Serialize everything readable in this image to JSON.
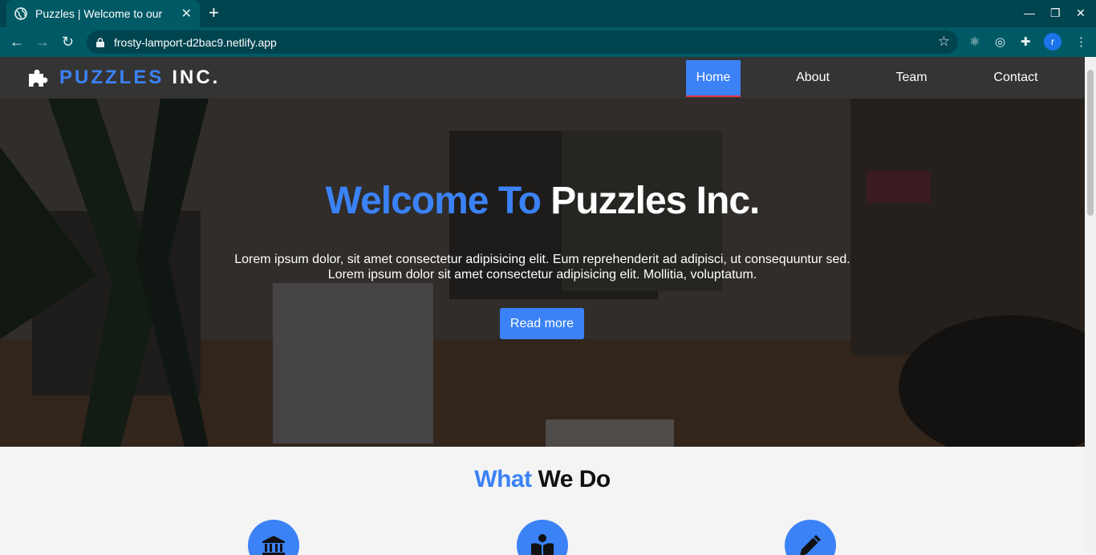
{
  "browser": {
    "tab_title": "Puzzles | Welcome to our",
    "url": "frosty-lamport-d2bac9.netlify.app",
    "profile_initial": "r"
  },
  "navbar": {
    "brand_part1": "PUZZLES",
    "brand_part2": "INC.",
    "items": [
      {
        "label": "Home",
        "active": true
      },
      {
        "label": "About",
        "active": false
      },
      {
        "label": "Team",
        "active": false
      },
      {
        "label": "Contact",
        "active": false
      }
    ]
  },
  "hero": {
    "title_part1": "Welcome To",
    "title_part2": "Puzzles Inc.",
    "text_line1": "Lorem ipsum dolor, sit amet consectetur adipisicing elit. Eum reprehenderit ad adipisci, ut consequuntur sed.",
    "text_line2": "Lorem ipsum dolor sit amet consectetur adipisicing elit. Mollitia, voluptatum.",
    "button_label": "Read more"
  },
  "what_we_do": {
    "title_part1": "What",
    "title_part2": "We Do",
    "icons": [
      "bank-icon",
      "book-reader-icon",
      "pencil-icon"
    ]
  },
  "colors": {
    "accent": "#3b82f6",
    "navbar_bg": "#343434",
    "browser_frame": "#005a66",
    "active_underline": "#e0384a"
  }
}
